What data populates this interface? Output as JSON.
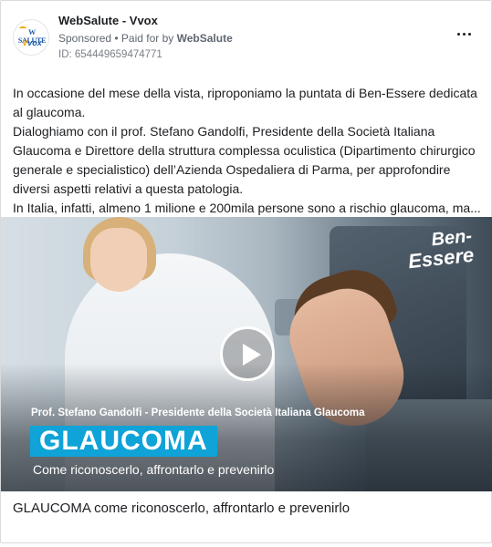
{
  "header": {
    "page_name": "WebSalute - Vvox",
    "sponsored_label": "Sponsored",
    "paid_for_prefix": "• Paid for by",
    "paid_for_by": "WebSalute",
    "ad_id": "ID: 654449659474771",
    "avatar": {
      "logo_top": "W SALUTE",
      "logo_bottom_prefix": "V",
      "logo_bottom_rest": "vox"
    },
    "more_icon": "more-horizontal-icon"
  },
  "body": {
    "lines": [
      "In occasione del mese della vista, riproponiamo la puntata di Ben-Essere dedicata",
      "al glaucoma.",
      "Dialoghiamo con il prof. Stefano Gandolfi, Presidente della Società Italiana",
      "Glaucoma e Direttore della struttura complessa oculistica (Dipartimento chirurgico",
      "generale e specialistico) dell’Azienda Ospedaliera di Parma, per approfondire",
      "diversi aspetti relativi a questa patologia.",
      "In Italia, infatti, almeno 1 milione e 200mila persone sono a rischio glaucoma, ma..."
    ]
  },
  "video": {
    "brand_line1": "Ben-",
    "brand_line2": "Essere",
    "play_icon": "play-icon",
    "caption": "Prof. Stefano Gandolfi - Presidente della Società Italiana Glaucoma",
    "title": "GLAUCOMA",
    "subtitle": "Come riconoscerlo, affrontarlo e prevenirlo",
    "accent_color": "#0fa3d8"
  },
  "footer": {
    "title": "GLAUCOMA come riconoscerlo, affrontarlo e prevenirlo"
  }
}
